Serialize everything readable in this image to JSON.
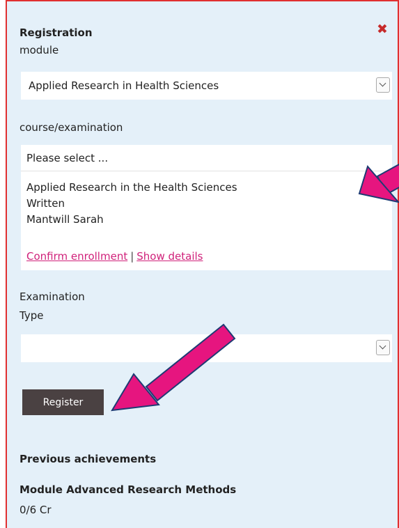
{
  "header": {
    "title": "Registration"
  },
  "module": {
    "label": "module",
    "selected": "Applied Research in Health Sciences"
  },
  "course": {
    "label": "course/examination",
    "placeholder": "Please select ...",
    "lines": [
      "Applied Research in the Health Sciences",
      "Written",
      "Mantwill Sarah"
    ],
    "confirm_link": "Confirm enrollment",
    "separator": "|",
    "details_link": "Show details"
  },
  "exam_type": {
    "label_line1": "Examination",
    "label_line2": "Type",
    "selected": ""
  },
  "register_button": "Register",
  "previous": {
    "heading": "Previous achievements",
    "module_title": "Module Advanced Research Methods",
    "credits": "0/6 Cr"
  },
  "colors": {
    "panel_bg": "#e4f0f9",
    "border": "#e03030",
    "close": "#c62b2b",
    "link": "#d0217a",
    "button_bg": "#4a4142",
    "arrow_fill": "#e6157f",
    "arrow_stroke": "#1f3a73"
  },
  "icons": {
    "close": "close-icon",
    "dropdown": "chevron-down-icon",
    "annotation": "arrow-annotation"
  }
}
